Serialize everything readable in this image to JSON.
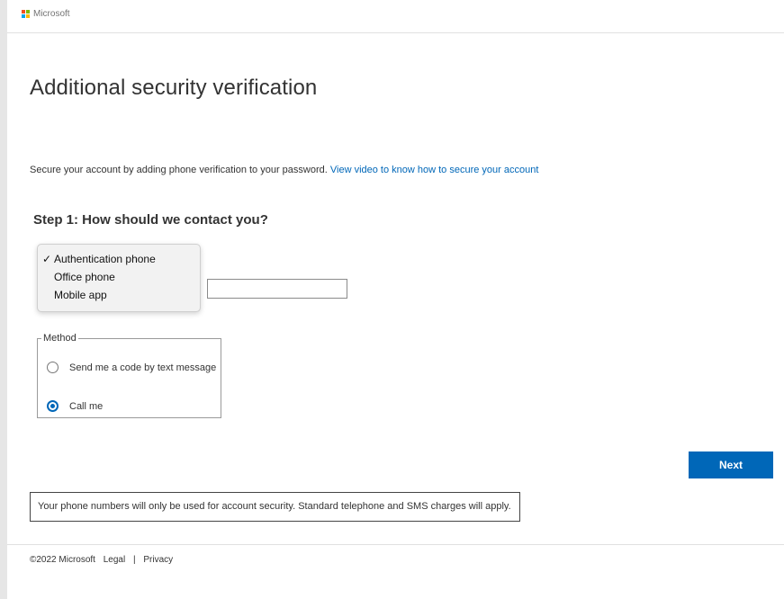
{
  "brand": {
    "name": "Microsoft",
    "logo_colors": [
      "#f25022",
      "#7fba00",
      "#00a4ef",
      "#ffb900"
    ]
  },
  "page": {
    "title": "Additional security verification",
    "intro_text": "Secure your account by adding phone verification to your password.",
    "intro_link": "View video to know how to secure your account",
    "step_heading": "Step 1: How should we contact you?"
  },
  "contact_dropdown": {
    "selected_check": "✓",
    "options": [
      {
        "label": "Authentication phone",
        "selected": true
      },
      {
        "label": "Office phone",
        "selected": false
      },
      {
        "label": "Mobile app",
        "selected": false
      }
    ]
  },
  "phone_input": {
    "value": ""
  },
  "method": {
    "legend": "Method",
    "options": [
      {
        "label": "Send me a code by text message",
        "checked": false
      },
      {
        "label": "Call me",
        "checked": true
      }
    ]
  },
  "actions": {
    "next_label": "Next"
  },
  "notice": "Your phone numbers will only be used for account security. Standard telephone and SMS charges will apply.",
  "footer": {
    "copyright": "©2022 Microsoft",
    "legal": "Legal",
    "separator": "|",
    "privacy": "Privacy"
  },
  "colors": {
    "accent": "#0067b8"
  }
}
